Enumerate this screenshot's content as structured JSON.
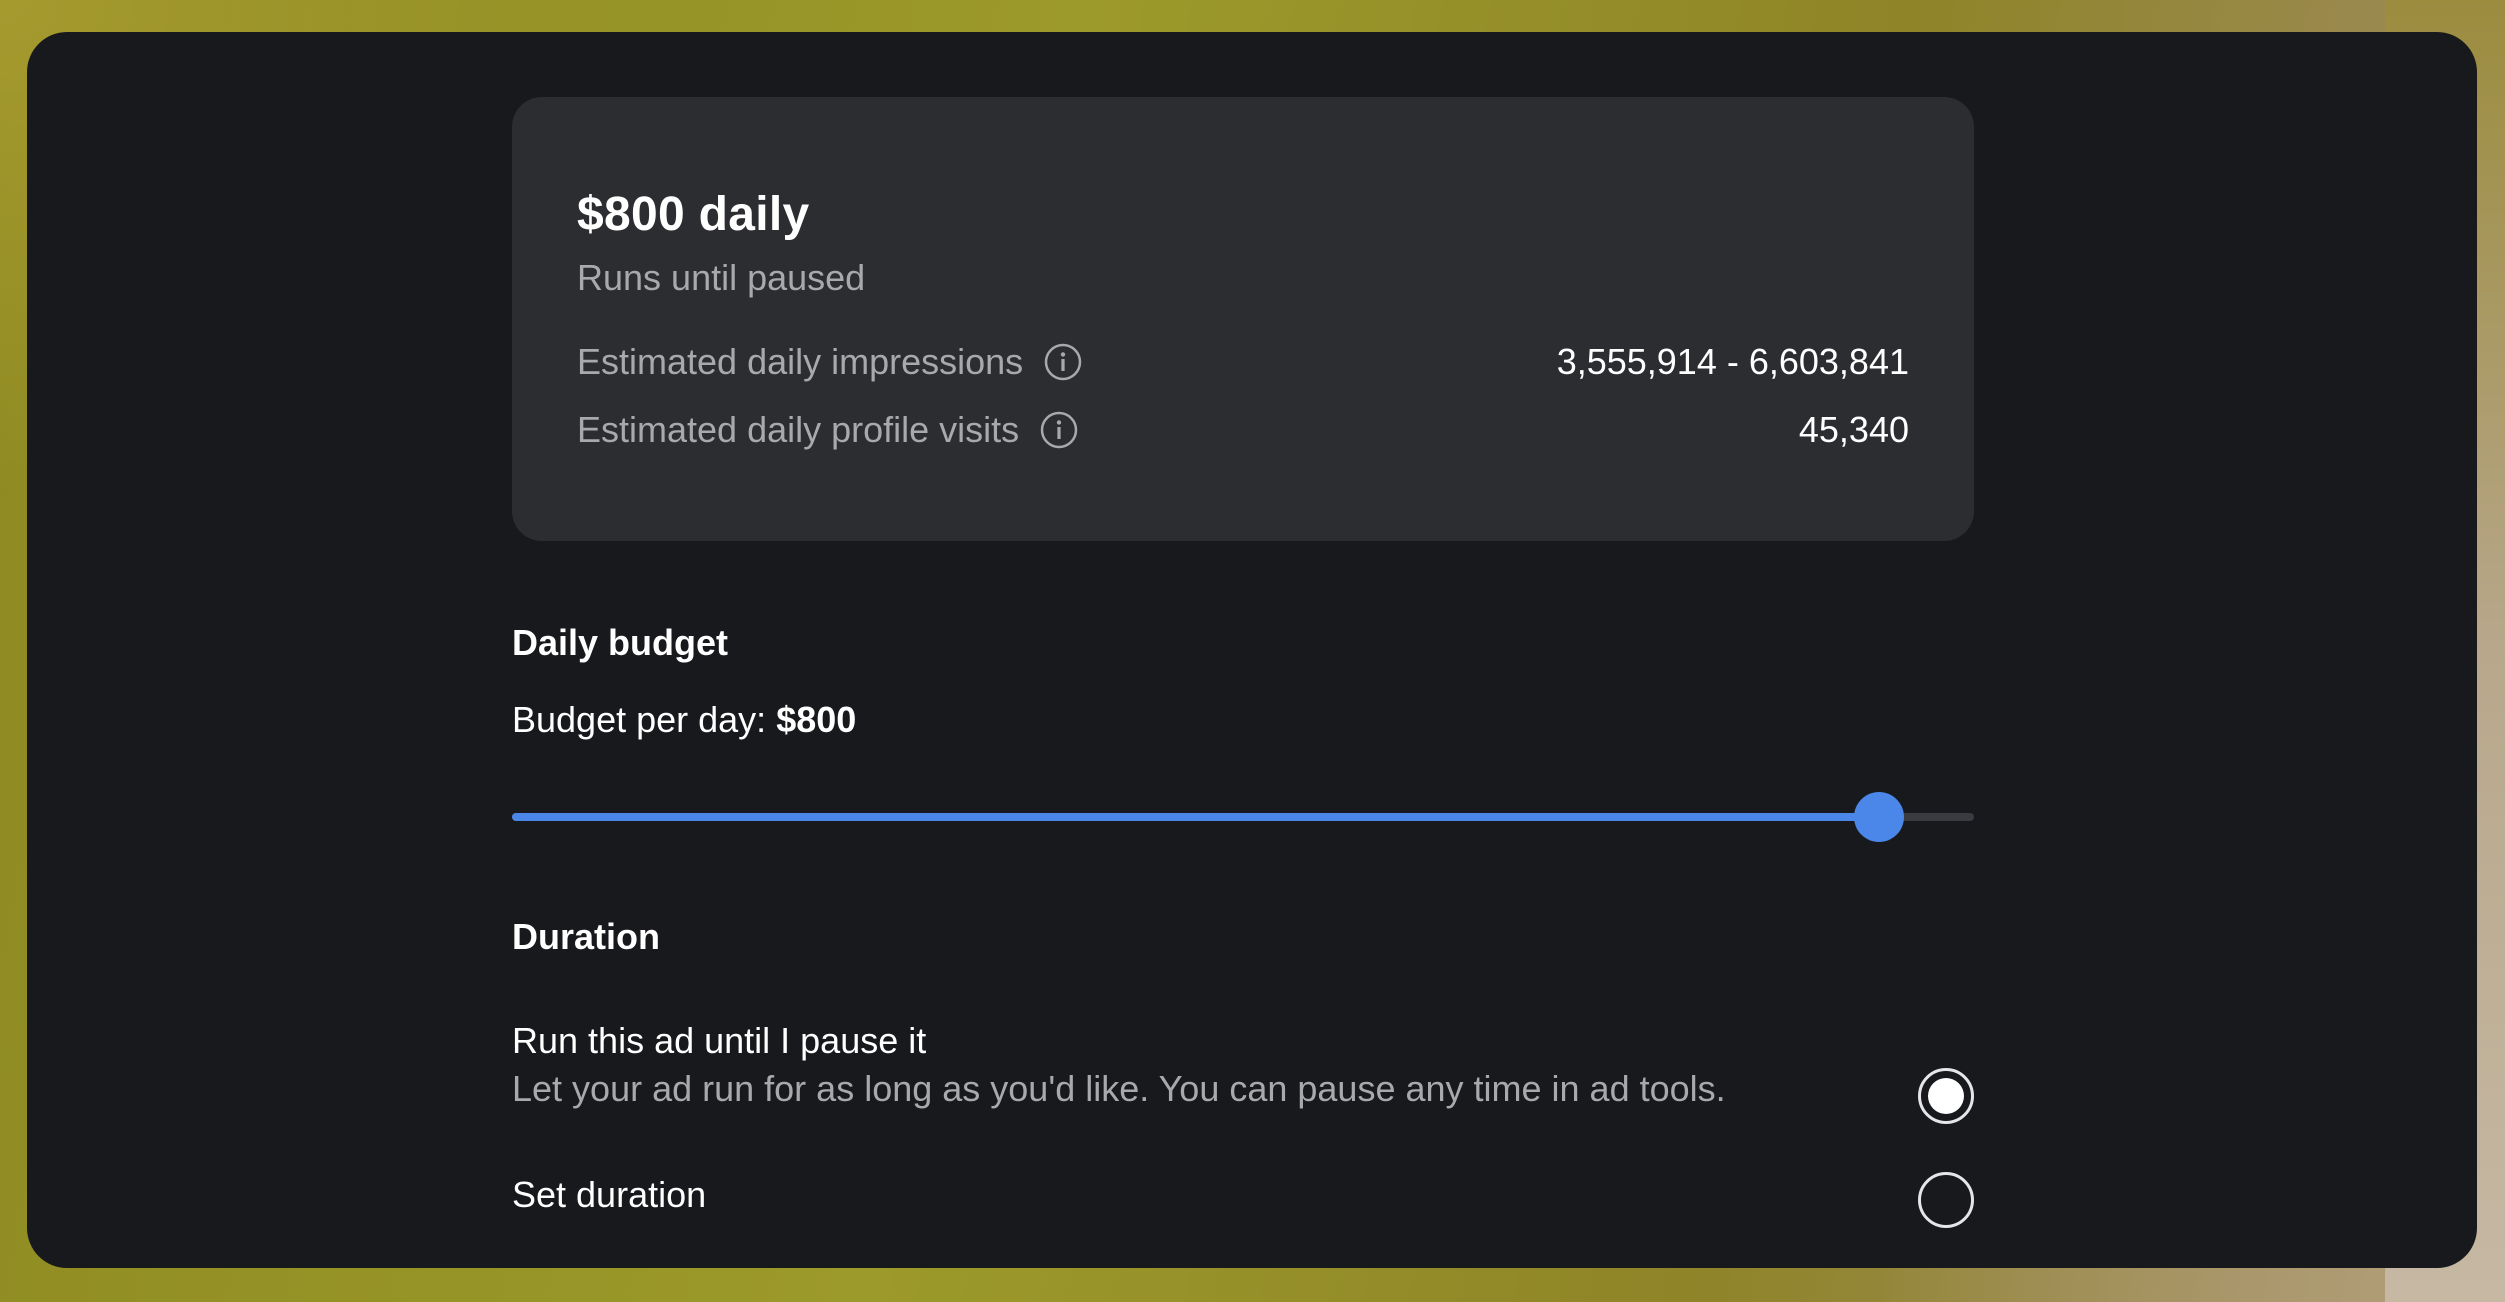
{
  "summary": {
    "title": "$800 daily",
    "subtitle": "Runs until paused",
    "metrics": [
      {
        "label": "Estimated daily impressions",
        "icon": "info-icon",
        "value": "3,555,914 - 6,603,841"
      },
      {
        "label": "Estimated daily profile visits",
        "icon": "info-icon",
        "value": "45,340"
      }
    ]
  },
  "budget": {
    "section_title": "Daily budget",
    "label_prefix": "Budget per day:",
    "amount": "$800",
    "slider_fraction": 0.935,
    "accent_color": "#4a87e8"
  },
  "duration": {
    "section_title": "Duration",
    "options": [
      {
        "title": "Run this ad until I pause it",
        "description": "Let your ad run for as long as you'd like. You can pause any time in ad tools.",
        "selected": true
      },
      {
        "title": "Set duration",
        "description": "",
        "selected": false
      }
    ]
  }
}
